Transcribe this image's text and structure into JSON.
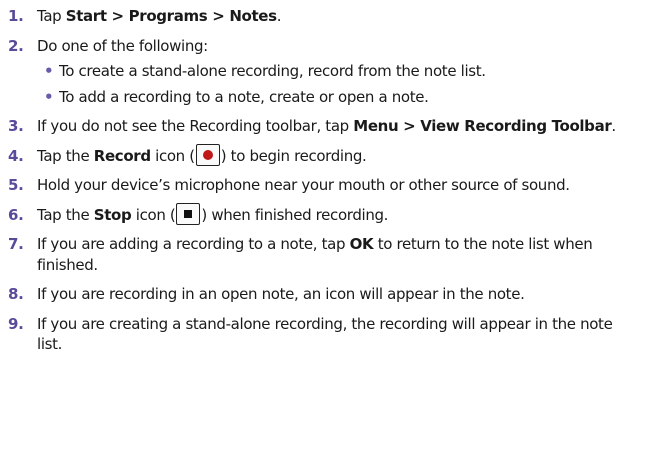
{
  "steps": [
    {
      "num": "1.",
      "parts": [
        {
          "t": "Tap "
        },
        {
          "t": "Start > Programs > Notes",
          "b": true
        },
        {
          "t": "."
        }
      ]
    },
    {
      "num": "2.",
      "parts": [
        {
          "t": "Do one of the following:"
        }
      ],
      "bullets": [
        "To create a stand-alone recording, record from the note list.",
        "To add a recording to a note, create or open a note."
      ]
    },
    {
      "num": "3.",
      "parts": [
        {
          "t": "If you do not see the Recording toolbar, tap "
        },
        {
          "t": "Menu > View Recording Toolbar",
          "b": true
        },
        {
          "t": "."
        }
      ]
    },
    {
      "num": "4.",
      "parts": [
        {
          "t": "Tap the "
        },
        {
          "t": "Record",
          "b": true
        },
        {
          "t": " icon ("
        },
        {
          "icon": "record-icon"
        },
        {
          "t": ") to begin recording."
        }
      ]
    },
    {
      "num": "5.",
      "parts": [
        {
          "t": "Hold your device’s microphone near your mouth or other source of sound."
        }
      ]
    },
    {
      "num": "6.",
      "parts": [
        {
          "t": "Tap the "
        },
        {
          "t": "Stop",
          "b": true
        },
        {
          "t": " icon ("
        },
        {
          "icon": "stop-icon"
        },
        {
          "t": ") when finished recording."
        }
      ]
    },
    {
      "num": "7.",
      "parts": [
        {
          "t": "If you are adding a recording to a note, tap "
        },
        {
          "t": "OK",
          "b": true
        },
        {
          "t": " to return to the note list when finished."
        }
      ]
    },
    {
      "num": "8.",
      "parts": [
        {
          "t": "If you are recording in an open note, an icon will appear in the note."
        }
      ]
    },
    {
      "num": "9.",
      "parts": [
        {
          "t": "If you are creating a stand-alone recording, the recording will appear in the note list."
        }
      ]
    }
  ],
  "colors": {
    "number": "#5a4a9a",
    "bullet": "#6a5aaa",
    "record_dot": "#c01818"
  }
}
